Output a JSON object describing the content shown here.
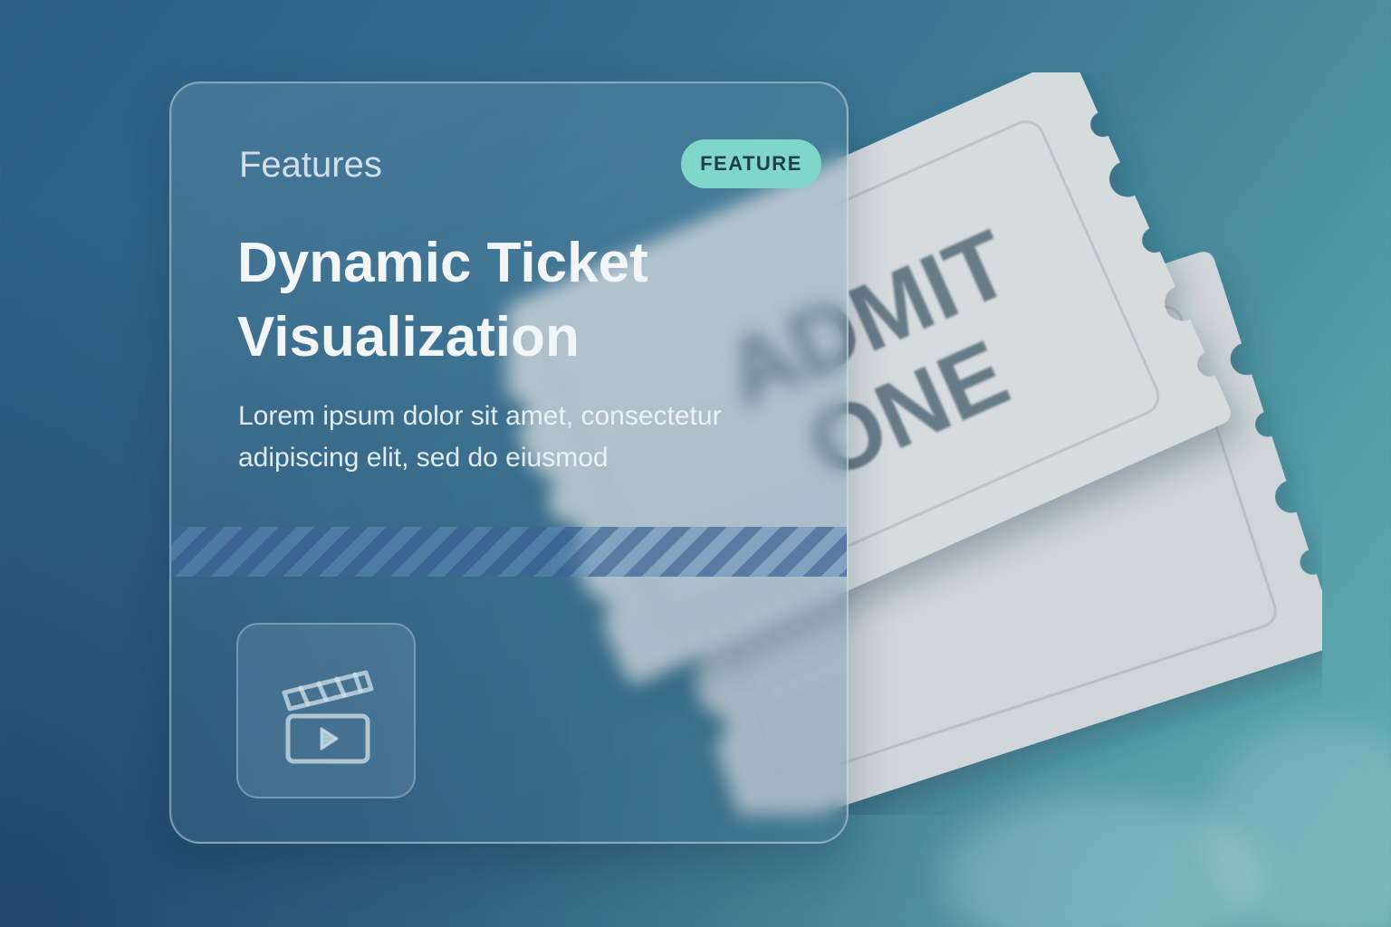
{
  "card": {
    "section_label": "Features",
    "badge": "FEATURE",
    "title_line1": "Dynamic Ticket",
    "title_line2": "Visualization",
    "body_line1": "Lorem ipsum dolor sit amet, consectetur",
    "body_line2": "adipiscing elit, sed do eiusmod",
    "icon": "clapperboard-play-icon"
  },
  "ticket": {
    "text_line1": "ADMIT",
    "text_line2": "ONE"
  },
  "colors": {
    "badge_bg": "#7fd6c9",
    "badge_text": "#1e3f4a",
    "ticket": "#d4d9dc",
    "ticket_text": "#667a86"
  }
}
